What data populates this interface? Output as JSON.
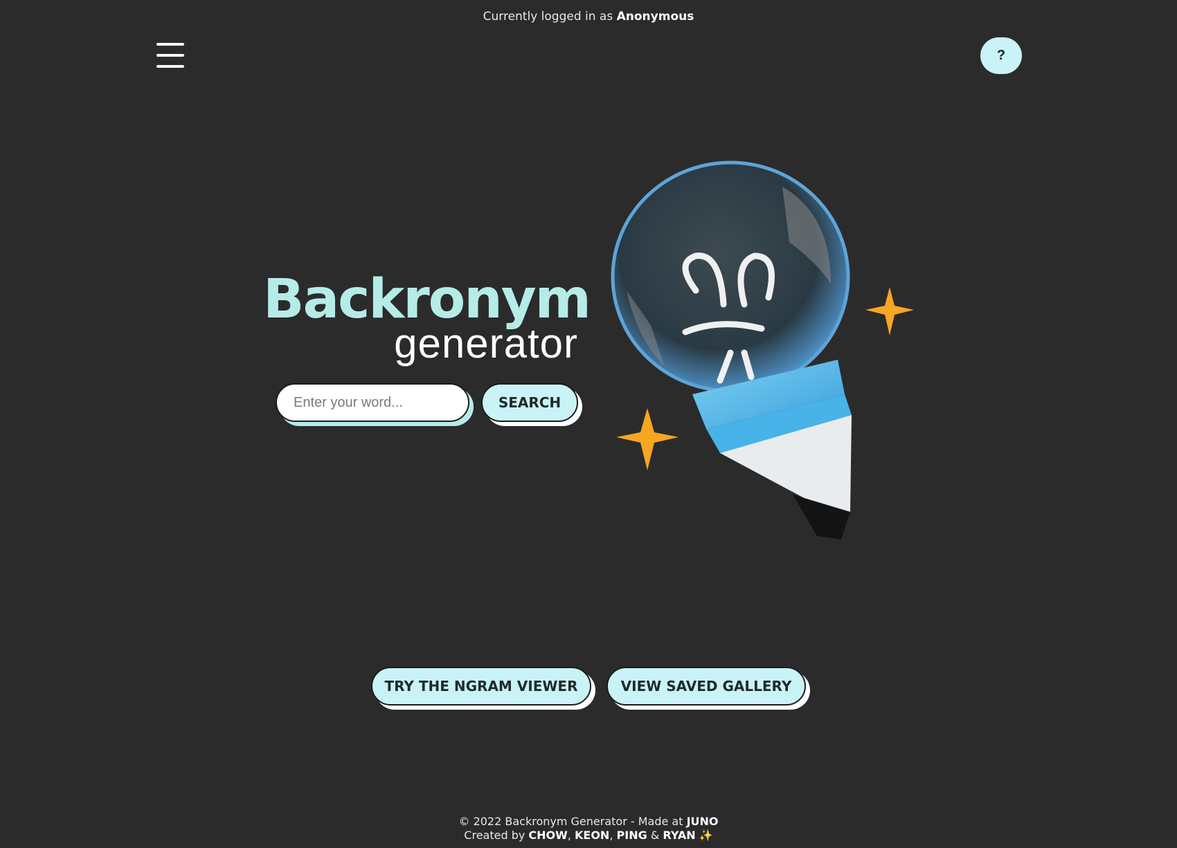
{
  "header": {
    "login_prefix": "Currently logged in as",
    "login_user": "Anonymous",
    "help_label": "?"
  },
  "hero": {
    "title": "Backronym",
    "subtitle": "generator"
  },
  "search": {
    "placeholder": "Enter your word...",
    "button_label": "SEARCH"
  },
  "actions": {
    "ngram_label": "TRY THE NGRAM VIEWER",
    "gallery_label": "VIEW SAVED GALLERY"
  },
  "footer": {
    "line1_prefix": "© 2022 Backronym Generator - Made at",
    "line1_org": "JUNO",
    "line2_prefix": "Created by",
    "creators": [
      "CHOW",
      "KEON",
      "PING",
      "RYAN"
    ],
    "sep_comma": ",",
    "sep_amp": "&",
    "sparkle": "✨"
  },
  "icons": {
    "menu": "hamburger-menu-icon",
    "illustration": "lightbulb-pencil-illustration",
    "stars": "sparkle-star-icon"
  },
  "colors": {
    "background": "#2c2b2c",
    "accent": "#c9f3f6",
    "title": "#b5ece8",
    "star": "#f5a623"
  }
}
